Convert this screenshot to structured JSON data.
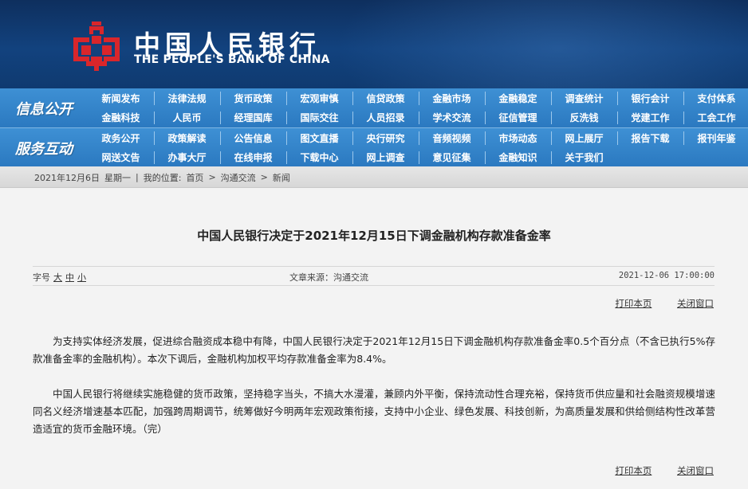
{
  "header": {
    "logo_cn": "中国人民银行",
    "logo_en": "THE PEOPLE'S BANK OF CHINA",
    "emblem_icon": "pboc-emblem-icon",
    "emblem_color": "#d9262b"
  },
  "nav": {
    "section1_title": "信息公开",
    "section1_items": [
      "新闻发布",
      "法律法规",
      "货币政策",
      "宏观审慎",
      "信贷政策",
      "金融市场",
      "金融稳定",
      "调查统计",
      "银行会计",
      "支付体系",
      "金融科技",
      "人民币",
      "经理国库",
      "国际交往",
      "人员招录",
      "学术交流",
      "征信管理",
      "反洗钱",
      "党建工作",
      "工会工作"
    ],
    "section2_title": "服务互动",
    "section2_items": [
      "政务公开",
      "政策解读",
      "公告信息",
      "图文直播",
      "央行研究",
      "音频视频",
      "市场动态",
      "网上展厅",
      "报告下载",
      "报刊年鉴",
      "网送文告",
      "办事大厅",
      "在线申报",
      "下载中心",
      "网上调查",
      "意见征集",
      "金融知识",
      "关于我们"
    ]
  },
  "breadcrumb": {
    "date": "2021年12月6日",
    "weekday": "星期一",
    "separator": "|",
    "location_label": "我的位置:",
    "home": "首页",
    "sep1": ">",
    "section": "沟通交流",
    "sep2": ">",
    "current": "新闻"
  },
  "article": {
    "title": "中国人民银行决定于2021年12月15日下调金融机构存款准备金率",
    "font_label": "字号",
    "font_large": "大",
    "font_medium": "中",
    "font_small": "小",
    "source": "文章来源：沟通交流",
    "date": "2021-12-06 17:00:00",
    "print_label": "打印本页",
    "close_label": "关闭窗口",
    "paragraphs": [
      "为支持实体经济发展，促进综合融资成本稳中有降，中国人民银行决定于2021年12月15日下调金融机构存款准备金率0.5个百分点（不含已执行5%存款准备金率的金融机构）。本次下调后，金融机构加权平均存款准备金率为8.4%。",
      "中国人民银行将继续实施稳健的货币政策，坚持稳字当头，不搞大水漫灌，兼顾内外平衡，保持流动性合理充裕，保持货币供应量和社会融资规模增速同名义经济增速基本匹配，加强跨周期调节，统筹做好今明两年宏观政策衔接，支持中小企业、绿色发展、科技创新，为高质量发展和供给侧结构性改革营造适宜的货币金融环境。（完）"
    ]
  }
}
